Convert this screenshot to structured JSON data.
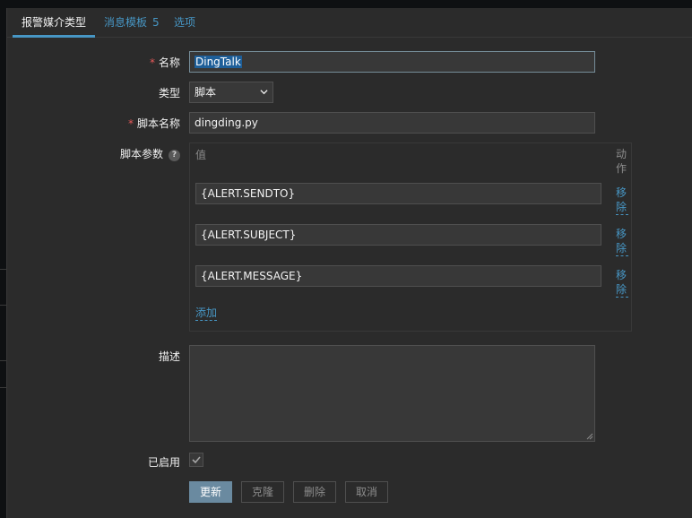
{
  "tabs": [
    {
      "label": "报警媒介类型",
      "active": true
    },
    {
      "label": "消息模板",
      "count": "5"
    },
    {
      "label": "选项"
    }
  ],
  "form": {
    "name": {
      "label": "名称",
      "required": true,
      "value": "DingTalk"
    },
    "type": {
      "label": "类型",
      "selected": "脚本"
    },
    "script_name": {
      "label": "脚本名称",
      "required": true,
      "value": "dingding.py"
    },
    "script_params": {
      "label": "脚本参数",
      "help_icon": "question-mark-icon",
      "col_value": "值",
      "col_action": "动作",
      "rows": [
        {
          "value": "{ALERT.SENDTO}",
          "remove": "移除"
        },
        {
          "value": "{ALERT.SUBJECT}",
          "remove": "移除"
        },
        {
          "value": "{ALERT.MESSAGE}",
          "remove": "移除"
        }
      ],
      "add_label": "添加"
    },
    "description": {
      "label": "描述",
      "value": ""
    },
    "enabled": {
      "label": "已启用",
      "checked": true
    }
  },
  "buttons": {
    "update": "更新",
    "clone": "克隆",
    "delete": "删除",
    "cancel": "取消"
  },
  "colors": {
    "accent": "#4796c4",
    "required": "#e45959",
    "primary_button": "#6a8aa0",
    "panel_bg": "#2b2b2b",
    "input_bg": "#383838"
  }
}
